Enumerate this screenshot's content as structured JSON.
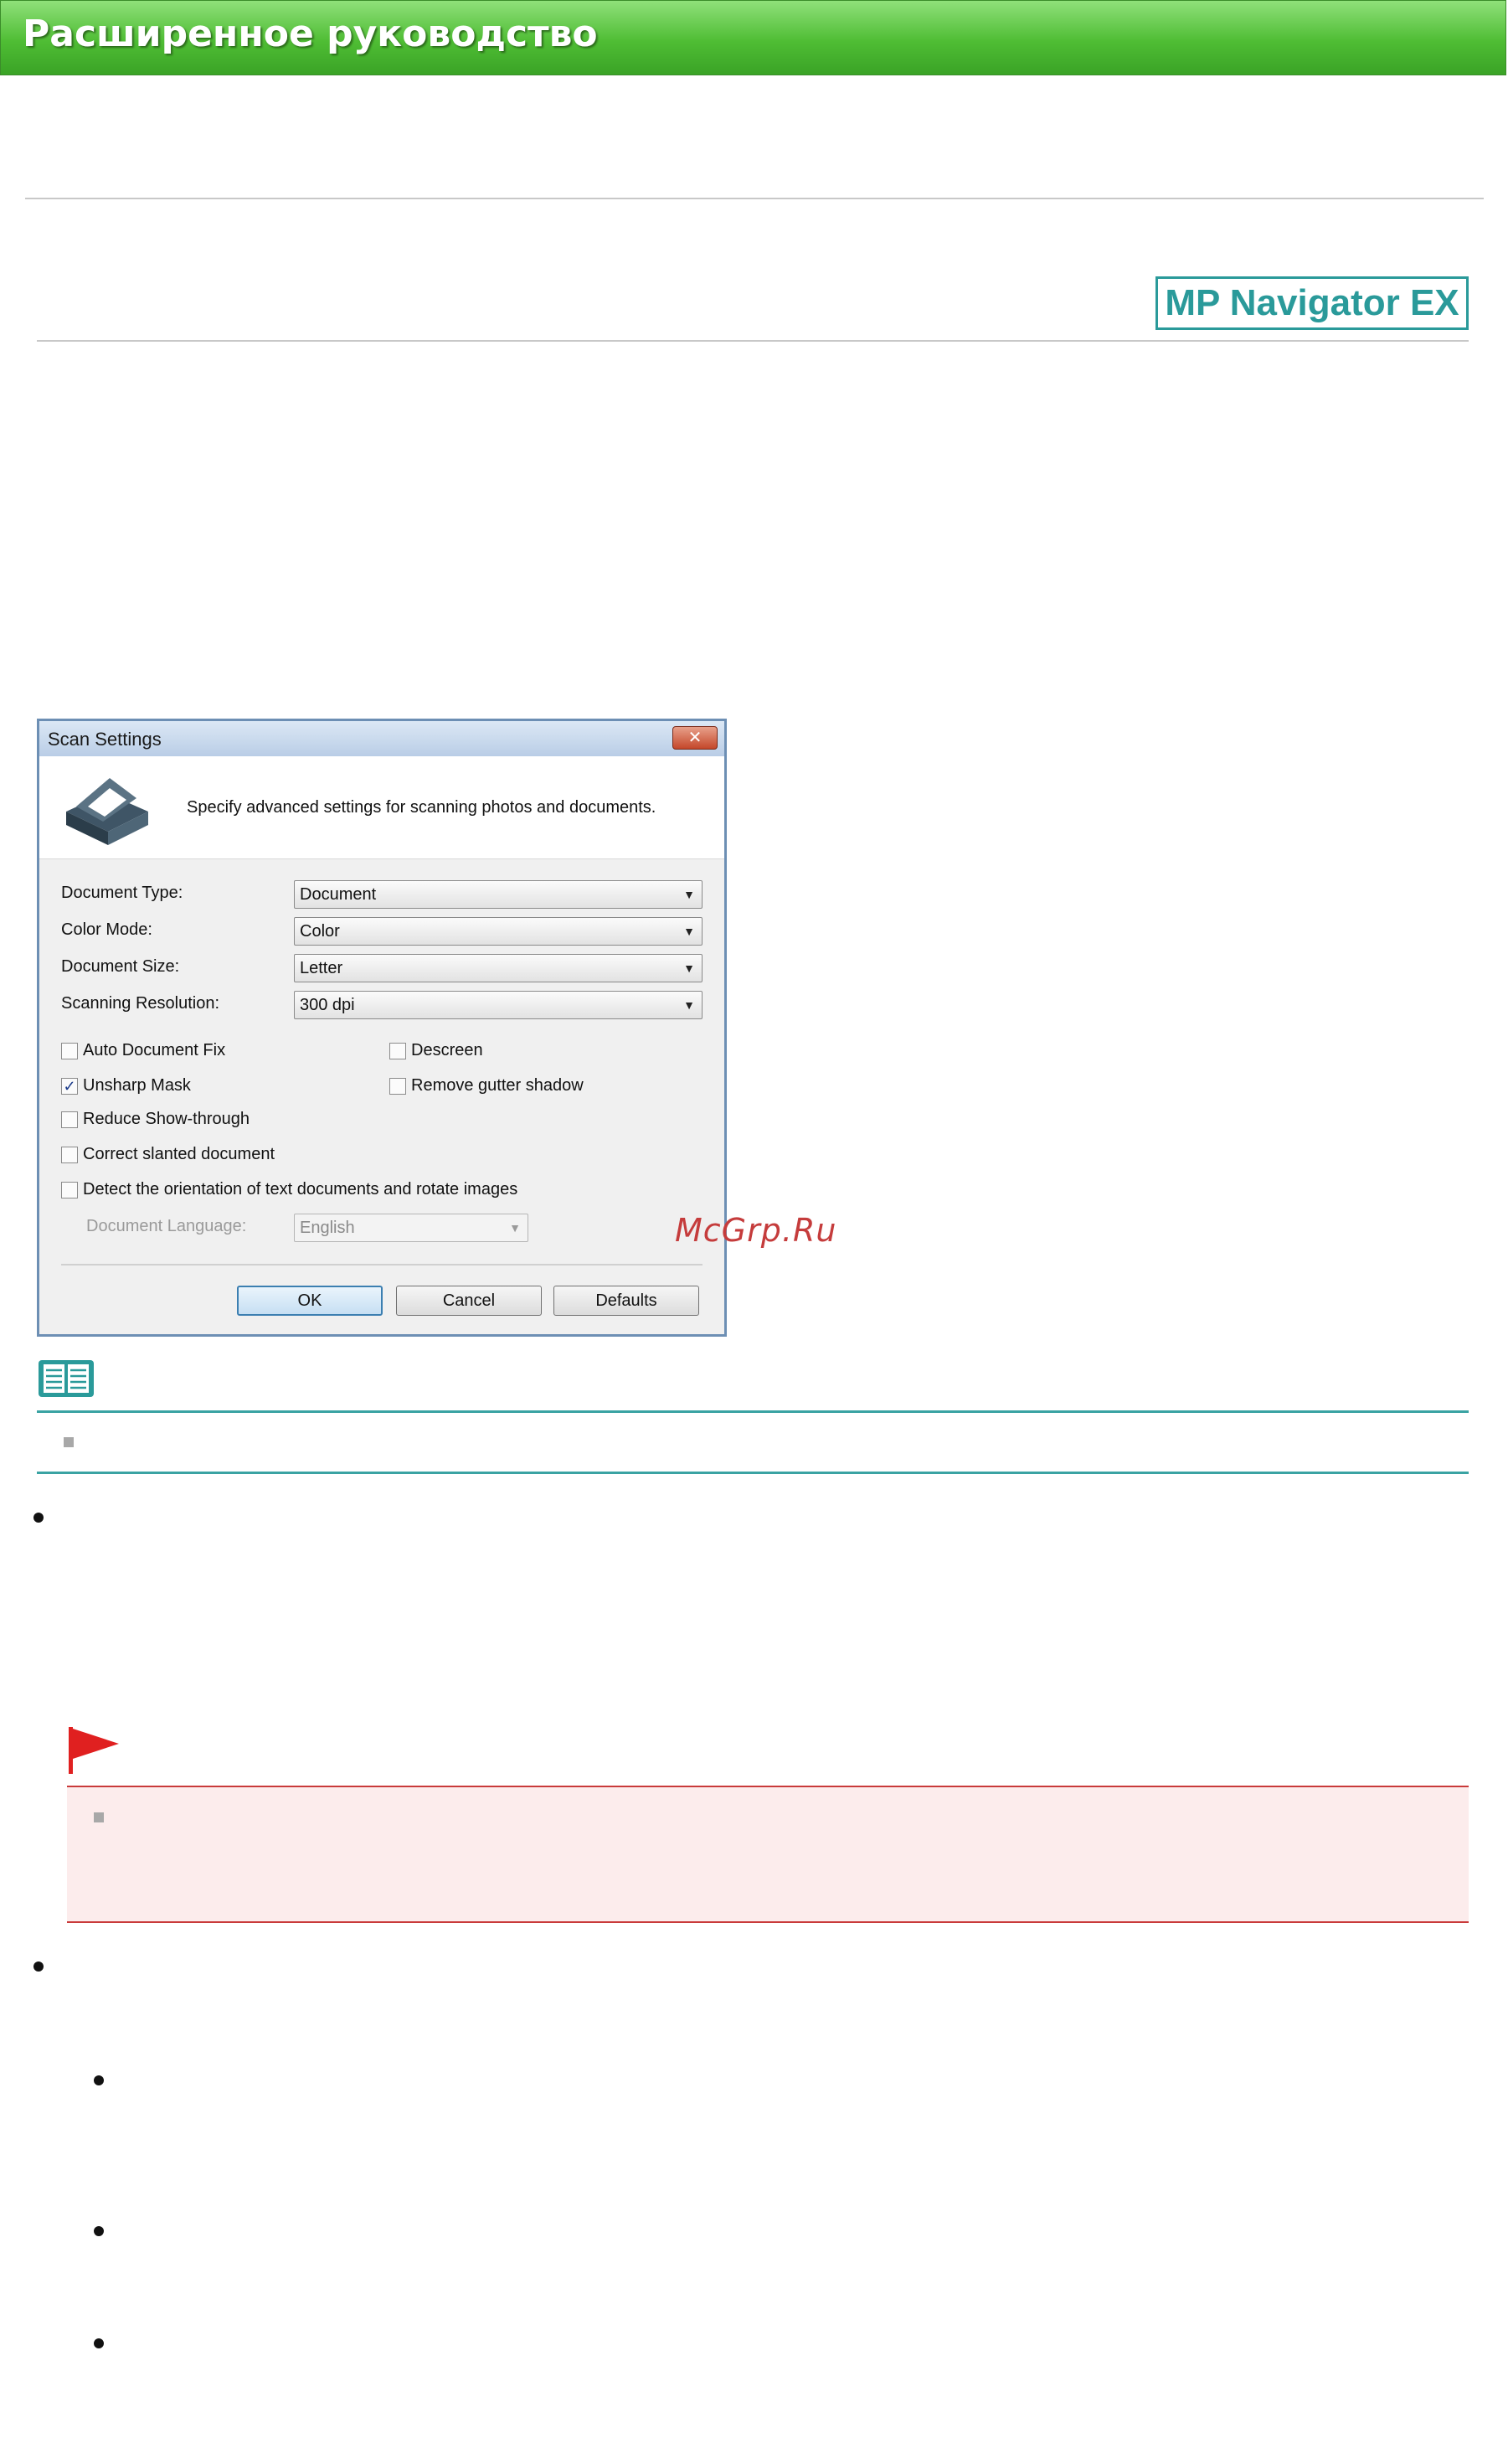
{
  "header": {
    "title": "Расширенное руководство"
  },
  "logo": {
    "text": "MP Navigator EX"
  },
  "dialog": {
    "title": "Scan Settings",
    "close_icon": "close-icon",
    "description": "Specify advanced settings for scanning photos and documents.",
    "fields": [
      {
        "label": "Document Type:",
        "value": "Document"
      },
      {
        "label": "Color Mode:",
        "value": "Color"
      },
      {
        "label": "Document Size:",
        "value": "Letter"
      },
      {
        "label": "Scanning Resolution:",
        "value": "300 dpi"
      }
    ],
    "checkboxes": {
      "auto_document_fix": {
        "label": "Auto Document Fix",
        "checked": false
      },
      "descreen": {
        "label": "Descreen",
        "checked": false
      },
      "unsharp_mask": {
        "label": "Unsharp Mask",
        "checked": true
      },
      "remove_gutter_shadow": {
        "label": "Remove gutter shadow",
        "checked": false
      },
      "reduce_show_through": {
        "label": "Reduce Show-through",
        "checked": false
      },
      "correct_slanted": {
        "label": "Correct slanted document",
        "checked": false
      },
      "detect_orientation": {
        "label": "Detect the orientation of text documents and rotate images",
        "checked": false
      }
    },
    "document_language": {
      "label": "Document Language:",
      "value": "English"
    },
    "buttons": {
      "ok": "OK",
      "cancel": "Cancel",
      "defaults": "Defaults"
    }
  },
  "watermark": "McGrp.Ru",
  "colors": {
    "banner": "#4fbd34",
    "logo": "#2a9a9a",
    "note_rule": "#3aa3a3",
    "important_rule": "#c93a3a",
    "important_bg": "#fcecec"
  }
}
